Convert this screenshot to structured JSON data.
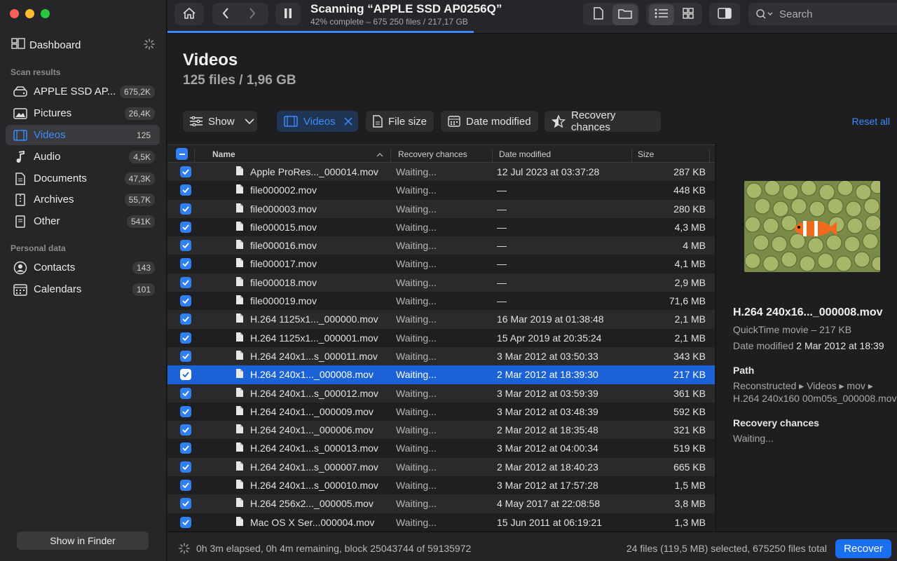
{
  "toolbar": {
    "scan_title": "Scanning “APPLE SSD AP0256Q”",
    "scan_subtitle": "42% complete – 675 250 files / 217,17 GB",
    "progress": 0.42,
    "search_placeholder": "Search"
  },
  "sidebar": {
    "dashboard": "Dashboard",
    "scan_results_label": "Scan results",
    "items": [
      {
        "label": "APPLE SSD AP...",
        "count": "675,2K",
        "icon": "disk-icon"
      },
      {
        "label": "Pictures",
        "count": "26,4K",
        "icon": "photo-icon"
      },
      {
        "label": "Videos",
        "count": "125",
        "icon": "film-icon"
      },
      {
        "label": "Audio",
        "count": "4,5K",
        "icon": "music-note-icon"
      },
      {
        "label": "Documents",
        "count": "47,3K",
        "icon": "document-icon"
      },
      {
        "label": "Archives",
        "count": "55,7K",
        "icon": "archive-icon"
      },
      {
        "label": "Other",
        "count": "541K",
        "icon": "file-icon"
      }
    ],
    "personal_label": "Personal data",
    "personal": [
      {
        "label": "Contacts",
        "count": "143",
        "icon": "contact-icon"
      },
      {
        "label": "Calendars",
        "count": "101",
        "icon": "calendar-icon"
      }
    ],
    "show_in_finder": "Show in Finder"
  },
  "main": {
    "title": "Videos",
    "subtitle": "125 files / 1,96 GB",
    "filters": {
      "show": "Show",
      "videos": "Videos",
      "file_size": "File size",
      "date_modified": "Date modified",
      "recovery_chances": "Recovery chances"
    },
    "reset_all": "Reset all"
  },
  "table": {
    "headers": {
      "name": "Name",
      "recovery": "Recovery chances",
      "date": "Date modified",
      "size": "Size"
    },
    "rows": [
      {
        "name": "Apple ProRes..._000014.mov",
        "rec": "Waiting...",
        "date": "12 Jul 2023 at 03:37:28",
        "size": "287 KB"
      },
      {
        "name": "file000002.mov",
        "rec": "Waiting...",
        "date": "—",
        "size": "448 KB"
      },
      {
        "name": "file000003.mov",
        "rec": "Waiting...",
        "date": "—",
        "size": "280 KB"
      },
      {
        "name": "file000015.mov",
        "rec": "Waiting...",
        "date": "—",
        "size": "4,3 MB"
      },
      {
        "name": "file000016.mov",
        "rec": "Waiting...",
        "date": "—",
        "size": "4 MB"
      },
      {
        "name": "file000017.mov",
        "rec": "Waiting...",
        "date": "—",
        "size": "4,1 MB"
      },
      {
        "name": "file000018.mov",
        "rec": "Waiting...",
        "date": "—",
        "size": "2,9 MB"
      },
      {
        "name": "file000019.mov",
        "rec": "Waiting...",
        "date": "—",
        "size": "71,6 MB"
      },
      {
        "name": "H.264 1125x1..._000000.mov",
        "rec": "Waiting...",
        "date": "16 Mar 2019 at 01:38:48",
        "size": "2,1 MB"
      },
      {
        "name": "H.264 1125x1..._000001.mov",
        "rec": "Waiting...",
        "date": "15 Apr 2019 at 20:35:24",
        "size": "2,1 MB"
      },
      {
        "name": "H.264 240x1...s_000011.mov",
        "rec": "Waiting...",
        "date": "3 Mar 2012 at 03:50:33",
        "size": "343 KB"
      },
      {
        "name": "H.264 240x1..._000008.mov",
        "rec": "Waiting...",
        "date": "2 Mar 2012 at 18:39:30",
        "size": "217 KB",
        "selected": true
      },
      {
        "name": "H.264 240x1...s_000012.mov",
        "rec": "Waiting...",
        "date": "3 Mar 2012 at 03:59:39",
        "size": "361 KB"
      },
      {
        "name": "H.264 240x1..._000009.mov",
        "rec": "Waiting...",
        "date": "3 Mar 2012 at 03:48:39",
        "size": "592 KB"
      },
      {
        "name": "H.264 240x1..._000006.mov",
        "rec": "Waiting...",
        "date": "2 Mar 2012 at 18:35:48",
        "size": "321 KB"
      },
      {
        "name": "H.264 240x1...s_000013.mov",
        "rec": "Waiting...",
        "date": "3 Mar 2012 at 04:00:34",
        "size": "519 KB"
      },
      {
        "name": "H.264 240x1...s_000007.mov",
        "rec": "Waiting...",
        "date": "2 Mar 2012 at 18:40:23",
        "size": "665 KB"
      },
      {
        "name": "H.264 240x1...s_000010.mov",
        "rec": "Waiting...",
        "date": "3 Mar 2012 at 17:57:28",
        "size": "1,5 MB"
      },
      {
        "name": "H.264 256x2..._000005.mov",
        "rec": "Waiting...",
        "date": "4 May 2017 at 22:08:58",
        "size": "3,8 MB"
      },
      {
        "name": "Mac OS X Ser...000004.mov",
        "rec": "Waiting...",
        "date": "15 Jun 2011 at 06:19:21",
        "size": "1,3 MB"
      }
    ]
  },
  "preview": {
    "name": "H.264 240x16..._000008.mov",
    "type": "QuickTime movie – 217 KB",
    "date_label": "Date modified",
    "date_value": "2 Mar 2012 at 18:39",
    "path_label": "Path",
    "path_value": "Reconstructed ▸ Videos ▸ mov ▸ H.264 240x160 00m05s_000008.mov",
    "recovery_label": "Recovery chances",
    "recovery_value": "Waiting..."
  },
  "status": {
    "elapsed": "0h 3m elapsed, 0h 4m remaining, block 25043744 of 59135972",
    "selection": "24 files (119,5 MB) selected, 675250 files total",
    "recover": "Recover"
  },
  "colors": {
    "accent": "#3b8cff",
    "selected_row": "#1a62d6"
  }
}
